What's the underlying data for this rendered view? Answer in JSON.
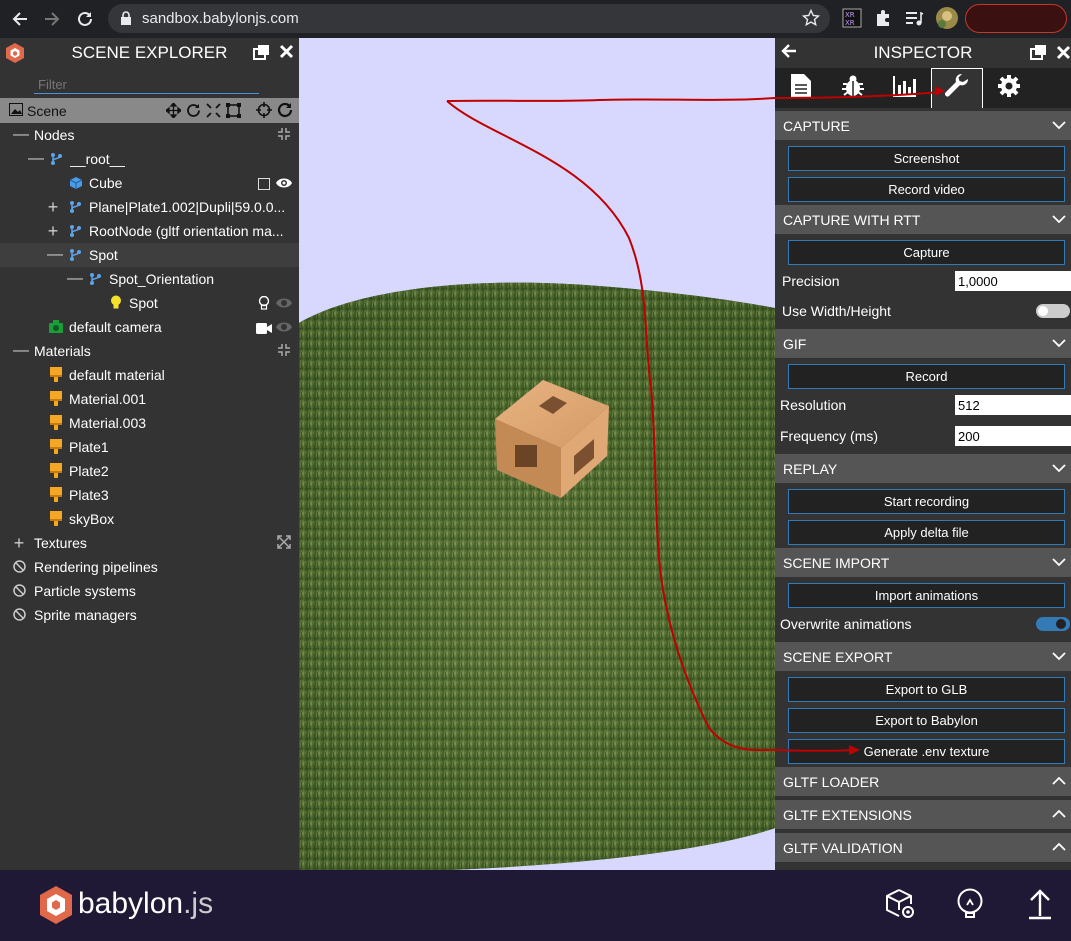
{
  "browser": {
    "url": "sandbox.babylonjs.com"
  },
  "explorer": {
    "title": "SCENE EXPLORER",
    "filter_placeholder": "Filter",
    "scene_label": "Scene",
    "nodes": [
      {
        "label": "Nodes"
      },
      {
        "label": "__root__"
      },
      {
        "label": "Cube"
      },
      {
        "label": "Plane|Plate1.002|Dupli|59.0.0..."
      },
      {
        "label": "RootNode (gltf orientation ma..."
      },
      {
        "label": "Spot"
      },
      {
        "label": "Spot_Orientation"
      },
      {
        "label": "Spot"
      },
      {
        "label": "default camera"
      },
      {
        "label": "Materials"
      },
      {
        "label": "default material"
      },
      {
        "label": "Material.001"
      },
      {
        "label": "Material.003"
      },
      {
        "label": "Plate1"
      },
      {
        "label": "Plate2"
      },
      {
        "label": "Plate3"
      },
      {
        "label": "skyBox"
      },
      {
        "label": "Textures"
      },
      {
        "label": "Rendering pipelines"
      },
      {
        "label": "Particle systems"
      },
      {
        "label": "Sprite managers"
      }
    ]
  },
  "inspector": {
    "title": "INSPECTOR",
    "sections": {
      "capture": "CAPTURE",
      "capture_rtt": "CAPTURE WITH RTT",
      "gif": "GIF",
      "replay": "REPLAY",
      "scene_import": "SCENE IMPORT",
      "scene_export": "SCENE EXPORT",
      "gltf_loader": "GLTF LOADER",
      "gltf_extensions": "GLTF EXTENSIONS",
      "gltf_validation": "GLTF VALIDATION"
    },
    "buttons": {
      "screenshot": "Screenshot",
      "record_video": "Record video",
      "capture": "Capture",
      "record": "Record",
      "start_recording": "Start recording",
      "apply_delta": "Apply delta file",
      "import_animations": "Import animations",
      "export_glb": "Export to GLB",
      "export_babylon": "Export to Babylon",
      "generate_env": "Generate .env texture"
    },
    "props": {
      "precision_label": "Precision",
      "precision_value": "1,0000",
      "use_wh_label": "Use Width/Height",
      "resolution_label": "Resolution",
      "resolution_value": "512",
      "frequency_label": "Frequency (ms)",
      "frequency_value": "200",
      "overwrite_label": "Overwrite animations"
    },
    "toggles": {
      "use_width_height": false,
      "overwrite_animations": true
    }
  },
  "footer": {
    "brand": "babylon",
    "brand_suffix": ".js"
  },
  "colors": {
    "accent": "#337ab7",
    "annotation": "#c00000",
    "footer_bg": "#201936"
  }
}
